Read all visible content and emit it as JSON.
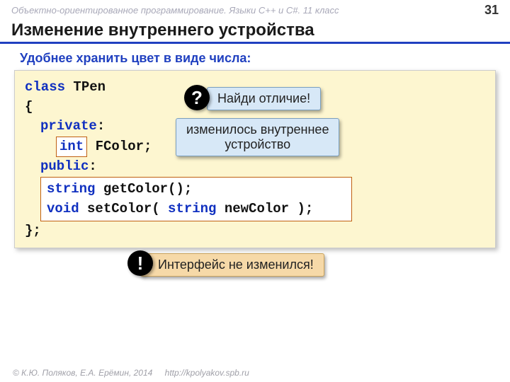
{
  "header": {
    "course": "Объектно-ориентированное программирование. Языки C++ и C#. 11 класс",
    "page": "31"
  },
  "title": "Изменение внутреннего устройства",
  "subtitle": "Удобнее хранить цвет в виде числа:",
  "code": {
    "l1_kw": "class",
    "l1_name": "TPen",
    "l2": "{",
    "l3_kw": "private",
    "l3_colon": ":",
    "l4_type": "int",
    "l4_field": " FColor;",
    "l5_kw": "public",
    "l5_colon": ":",
    "m1_type": "string",
    "m1_sig": " getColor();",
    "m2_type": "void",
    "m2_name": " setColor( ",
    "m2_ptype": "string",
    "m2_rest": " newColor );",
    "l8": "};"
  },
  "callouts": {
    "q_badge": "?",
    "find": "Найди отличие!",
    "changed_l1": "изменилось внутреннее",
    "changed_l2": "устройство",
    "excl_badge": "!",
    "iface": "Интерфейс не изменился!"
  },
  "footer": {
    "copyright": "© К.Ю. Поляков, Е.А. Ерёмин, 2014",
    "url": "http://kpolyakov.spb.ru"
  }
}
